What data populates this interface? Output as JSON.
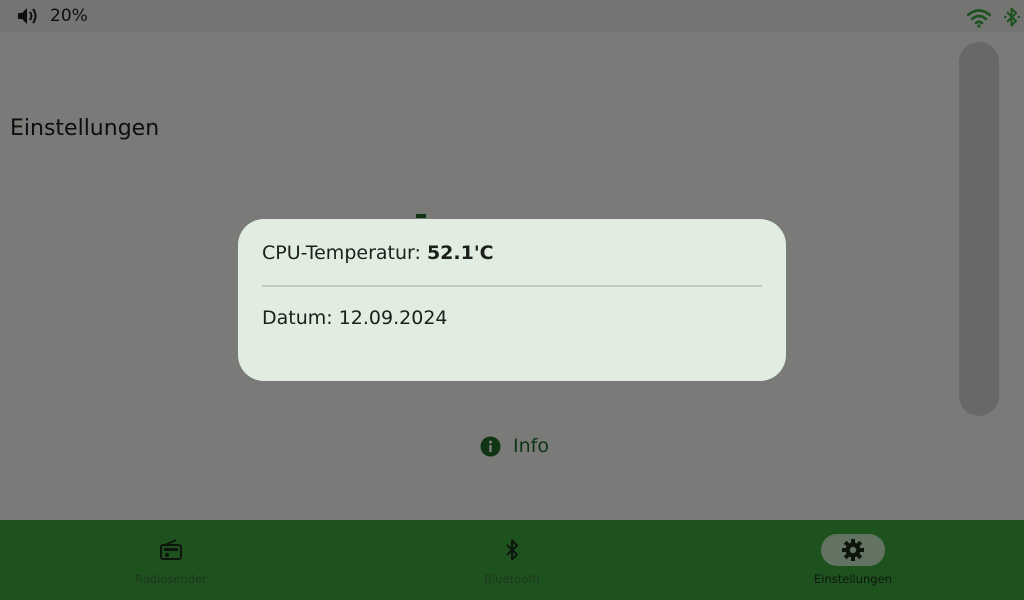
{
  "status_bar": {
    "volume_icon": "speaker-volume-icon",
    "volume_text": "20%",
    "wifi_icon": "wifi-icon",
    "bluetooth_icon": "bluetooth-icon",
    "status_icon_color": "#3aa53f"
  },
  "page": {
    "title": "Einstellungen",
    "info_label": "Info",
    "info_icon": "info-icon",
    "accent_color": "#1f6a2a"
  },
  "dialog": {
    "cpu_label": "CPU-Temperatur: ",
    "cpu_value": "52.1'C",
    "date_label": "Datum: ",
    "date_value": "12.09.2024"
  },
  "bottom_nav": {
    "items": [
      {
        "label": "Radiosender",
        "icon": "radio-icon",
        "active": false
      },
      {
        "label": "Bluetooth",
        "icon": "bluetooth-icon",
        "active": false
      },
      {
        "label": "Einstellungen",
        "icon": "gear-icon",
        "active": true
      }
    ],
    "background_color": "#3aa53f",
    "active_pill_color": "#c6e7c2"
  }
}
